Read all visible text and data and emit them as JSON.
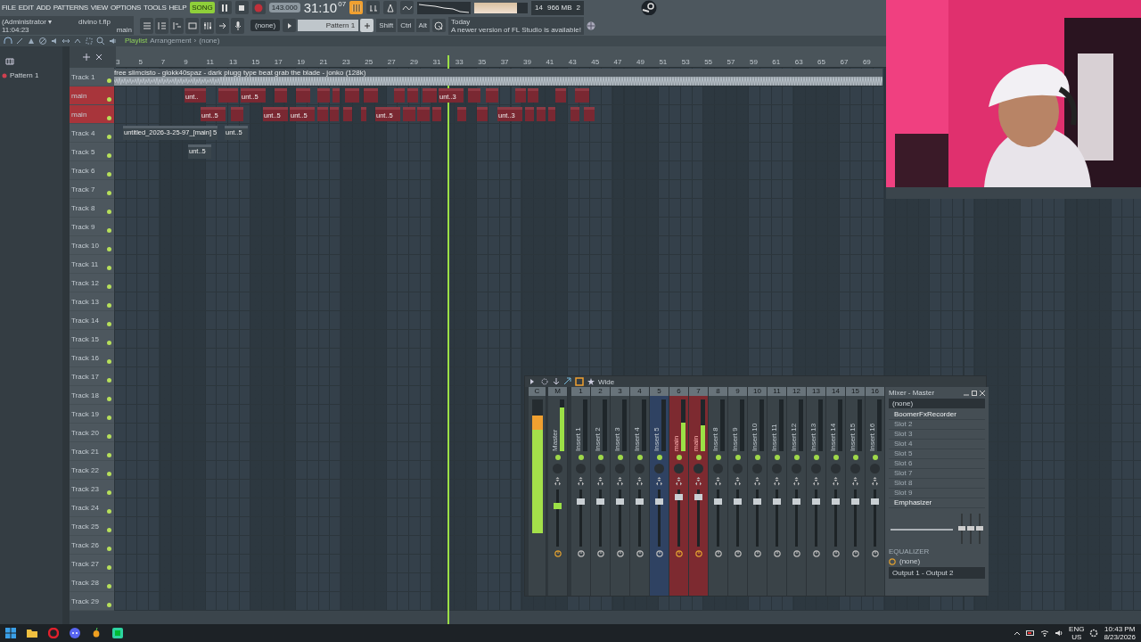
{
  "menu": [
    "FILE",
    "EDIT",
    "ADD",
    "PATTERNS",
    "VIEW",
    "OPTIONS",
    "TOOLS",
    "HELP"
  ],
  "transport": {
    "mode": "SONG",
    "tempo": "143.000",
    "time": "31:10",
    "ticks": "07"
  },
  "master_volume": {
    "level": 0.8
  },
  "monitor": {
    "cpu": "14",
    "memory": "966 MB",
    "polyphony": "2"
  },
  "project": {
    "user": "(Administrator ▾",
    "file": "divino t.flp",
    "clock": "11:04:23",
    "channel": "main"
  },
  "pattern_selector": {
    "preset": "(none)",
    "pattern": "Pattern 1"
  },
  "modifiers": [
    "Shift",
    "Ctrl",
    "Alt"
  ],
  "hint": {
    "when": "Today",
    "text": "A newer version of FL Studio is available!"
  },
  "browser": {
    "items": [
      {
        "label": "Pattern 1"
      }
    ]
  },
  "playlist": {
    "title": "Playlist",
    "section": "Arrangement",
    "separator": "›",
    "arrangement": "(none)",
    "ruler": [
      "3",
      "5",
      "7",
      "9",
      "11",
      "13",
      "15",
      "17",
      "19",
      "21",
      "23",
      "25",
      "27",
      "29",
      "31",
      "33",
      "35",
      "37",
      "39",
      "41",
      "43",
      "45",
      "47",
      "49",
      "51",
      "53",
      "55",
      "57",
      "59",
      "61",
      "63",
      "65",
      "67",
      "69"
    ],
    "tracks": [
      {
        "name": "Track 1",
        "color": "#4d575e",
        "clips": [
          {
            "kind": "audio",
            "label": "free slimcisto - glokk40spaz - dark plugg type beat grab the blade - jonko (128k)"
          }
        ]
      },
      {
        "name": "main",
        "color": "#a8353b",
        "clips": [
          {
            "kind": "pattern",
            "label": "unt.."
          },
          {
            "kind": "pattern"
          },
          {
            "kind": "pattern",
            "label": "unt..5"
          },
          {
            "kind": "pattern"
          },
          {
            "kind": "pattern"
          },
          {
            "kind": "pattern"
          },
          {
            "kind": "pattern"
          },
          {
            "kind": "pattern"
          },
          {
            "kind": "pattern"
          },
          {
            "kind": "pattern"
          },
          {
            "kind": "pattern"
          },
          {
            "kind": "pattern"
          },
          {
            "kind": "pattern",
            "label": "unt..3"
          },
          {
            "kind": "pattern"
          },
          {
            "kind": "pattern"
          },
          {
            "kind": "pattern"
          },
          {
            "kind": "pattern"
          },
          {
            "kind": "pattern"
          },
          {
            "kind": "pattern"
          }
        ]
      },
      {
        "name": "main",
        "color": "#a8353b",
        "clips": [
          {
            "kind": "pattern",
            "label": "unt..5"
          },
          {
            "kind": "pattern"
          },
          {
            "kind": "pattern",
            "label": "unt..5"
          },
          {
            "kind": "pattern",
            "label": "unt..5"
          },
          {
            "kind": "pattern"
          },
          {
            "kind": "pattern"
          },
          {
            "kind": "pattern"
          },
          {
            "kind": "pattern"
          },
          {
            "kind": "pattern",
            "label": "unt..5"
          },
          {
            "kind": "pattern"
          },
          {
            "kind": "pattern"
          },
          {
            "kind": "pattern"
          },
          {
            "kind": "pattern"
          },
          {
            "kind": "pattern"
          },
          {
            "kind": "pattern",
            "label": "unt..3"
          },
          {
            "kind": "pattern"
          },
          {
            "kind": "pattern"
          },
          {
            "kind": "pattern"
          },
          {
            "kind": "pattern"
          },
          {
            "kind": "pattern"
          }
        ]
      },
      {
        "name": "Track 4",
        "color": "#4d575e",
        "clips": [
          {
            "kind": "audio-pattern",
            "label": "untitled_2026-3-25-97_[main] 5"
          },
          {
            "kind": "audio-pattern",
            "label": "unt..5"
          }
        ]
      },
      {
        "name": "Track 5",
        "color": "#4d575e",
        "clips": [
          {
            "kind": "audio-pattern",
            "label": "unt..5"
          }
        ]
      },
      {
        "name": "Track 6",
        "color": "#4d575e"
      },
      {
        "name": "Track 7",
        "color": "#4d575e"
      },
      {
        "name": "Track 8",
        "color": "#4d575e"
      },
      {
        "name": "Track 9",
        "color": "#4d575e"
      },
      {
        "name": "Track 10",
        "color": "#4d575e"
      },
      {
        "name": "Track 11",
        "color": "#4d575e"
      },
      {
        "name": "Track 12",
        "color": "#4d575e"
      },
      {
        "name": "Track 13",
        "color": "#4d575e"
      },
      {
        "name": "Track 14",
        "color": "#4d575e"
      },
      {
        "name": "Track 15",
        "color": "#4d575e"
      },
      {
        "name": "Track 16",
        "color": "#4d575e"
      },
      {
        "name": "Track 17",
        "color": "#4d575e"
      },
      {
        "name": "Track 18",
        "color": "#4d575e"
      },
      {
        "name": "Track 19",
        "color": "#4d575e"
      },
      {
        "name": "Track 20",
        "color": "#4d575e"
      },
      {
        "name": "Track 21",
        "color": "#4d575e"
      },
      {
        "name": "Track 22",
        "color": "#4d575e"
      },
      {
        "name": "Track 23",
        "color": "#4d575e"
      },
      {
        "name": "Track 24",
        "color": "#4d575e"
      },
      {
        "name": "Track 25",
        "color": "#4d575e"
      },
      {
        "name": "Track 26",
        "color": "#4d575e"
      },
      {
        "name": "Track 27",
        "color": "#4d575e"
      },
      {
        "name": "Track 28",
        "color": "#4d575e"
      },
      {
        "name": "Track 29",
        "color": "#4d575e"
      }
    ]
  },
  "mixer": {
    "view": "Wide",
    "strips": [
      {
        "kind": "current",
        "header": "C",
        "meter": {
          "level": 0.88
        }
      },
      {
        "kind": "master",
        "header": "M",
        "name": "Master",
        "meter": {
          "level": 0.85
        },
        "fader": {
          "level": 0.7
        }
      },
      {
        "kind": "insert",
        "header": "1",
        "name": "Insert 1",
        "meter": {
          "level": 0
        },
        "fader": {
          "level": 0.78
        }
      },
      {
        "kind": "insert",
        "header": "2",
        "name": "Insert 2",
        "meter": {
          "level": 0
        },
        "fader": {
          "level": 0.78
        }
      },
      {
        "kind": "insert",
        "header": "3",
        "name": "Insert 3",
        "meter": {
          "level": 0
        },
        "fader": {
          "level": 0.78
        }
      },
      {
        "kind": "insert",
        "header": "4",
        "name": "Insert 4",
        "meter": {
          "level": 0
        },
        "fader": {
          "level": 0.78
        }
      },
      {
        "kind": "insert",
        "header": "5",
        "name": "Insert 5",
        "color": "#2f4262",
        "meter": {
          "level": 0
        },
        "fader": {
          "level": 0.78
        }
      },
      {
        "kind": "insert",
        "header": "6",
        "name": "main",
        "color": "#7d2a30",
        "meter": {
          "level": 0.55
        },
        "fader": {
          "level": 0.86
        }
      },
      {
        "kind": "insert",
        "header": "7",
        "name": "main",
        "color": "#7d2a30",
        "meter": {
          "level": 0.5
        },
        "fader": {
          "level": 0.86
        }
      },
      {
        "kind": "insert",
        "header": "8",
        "name": "Insert 8",
        "meter": {
          "level": 0
        },
        "fader": {
          "level": 0.78
        }
      },
      {
        "kind": "insert",
        "header": "9",
        "name": "Insert 9",
        "meter": {
          "level": 0
        },
        "fader": {
          "level": 0.78
        }
      },
      {
        "kind": "insert",
        "header": "10",
        "name": "Insert 10",
        "meter": {
          "level": 0
        },
        "fader": {
          "level": 0.78
        }
      },
      {
        "kind": "insert",
        "header": "11",
        "name": "Insert 11",
        "meter": {
          "level": 0
        },
        "fader": {
          "level": 0.78
        }
      },
      {
        "kind": "insert",
        "header": "12",
        "name": "Insert 12",
        "meter": {
          "level": 0
        },
        "fader": {
          "level": 0.78
        }
      },
      {
        "kind": "insert",
        "header": "13",
        "name": "Insert 13",
        "meter": {
          "level": 0
        },
        "fader": {
          "level": 0.78
        }
      },
      {
        "kind": "insert",
        "header": "14",
        "name": "Insert 14",
        "meter": {
          "level": 0
        },
        "fader": {
          "level": 0.78
        }
      },
      {
        "kind": "insert",
        "header": "15",
        "name": "Insert 15",
        "meter": {
          "level": 0
        },
        "fader": {
          "level": 0.78
        }
      },
      {
        "kind": "insert",
        "header": "16",
        "name": "Insert 16",
        "meter": {
          "level": 0
        },
        "fader": {
          "level": 0.78
        }
      }
    ],
    "panel": {
      "title": "Mixer - Master",
      "input": "(none)",
      "slots": [
        {
          "label": "BoomerFxRecorder",
          "enabled": true
        },
        {
          "label": "Slot 2",
          "enabled": false
        },
        {
          "label": "Slot 3",
          "enabled": false
        },
        {
          "label": "Slot 4",
          "enabled": false
        },
        {
          "label": "Slot 5",
          "enabled": false
        },
        {
          "label": "Slot 6",
          "enabled": false
        },
        {
          "label": "Slot 7",
          "enabled": false
        },
        {
          "label": "Slot 8",
          "enabled": false
        },
        {
          "label": "Slot 9",
          "enabled": false
        },
        {
          "label": "Emphasizer",
          "enabled": true
        }
      ],
      "eq_label": "EQUALIZER",
      "route": "(none)",
      "output": "Output 1 - Output 2"
    }
  },
  "taskbar": {
    "language": "ENG",
    "region": "US",
    "time": "10:43 PM",
    "date": "8/23/2026"
  }
}
